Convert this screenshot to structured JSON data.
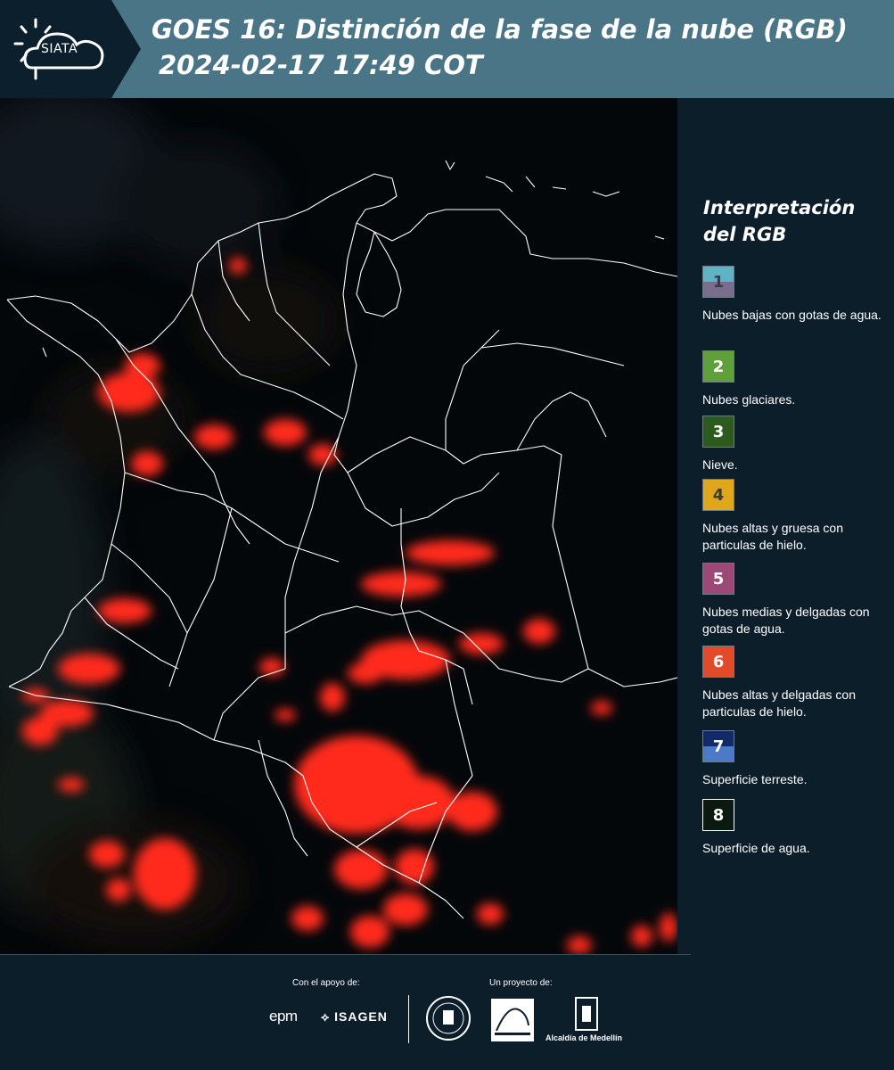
{
  "header": {
    "brand": "SIATA",
    "title_line1": "GOES 16: Distinción de la fase de la nube (RGB)",
    "title_line2": "2024-02-17 17:49 COT"
  },
  "colors": {
    "header_bg": "#4a7586",
    "page_bg": "#0d1e2b",
    "cloud_red": "#ff2a1a"
  },
  "legend": {
    "title": "Interpretación del RGB",
    "items": [
      {
        "number": "1",
        "label": "Nubes bajas con gotas de agua.",
        "color_top": "#5fb3c4",
        "color_bottom": "#7a6e8e"
      },
      {
        "number": "2",
        "label": "Nubes glaciares.",
        "color_top": "#5fa03a",
        "color_bottom": "#5fa03a"
      },
      {
        "number": "3",
        "label": "Nieve.",
        "color_top": "#2d5a1e",
        "color_bottom": "#2d5a1e"
      },
      {
        "number": "4",
        "label": "Nubes altas y gruesa con particulas de hielo.",
        "color_top": "#e0a71c",
        "color_bottom": "#e0a71c"
      },
      {
        "number": "5",
        "label": "Nubes medias y delgadas con gotas de agua.",
        "color_top": "#9e4878",
        "color_bottom": "#9e4878"
      },
      {
        "number": "6",
        "label": "Nubes altas y delgadas con particulas de hielo.",
        "color_top": "#e34a2a",
        "color_bottom": "#e34a2a"
      },
      {
        "number": "7",
        "label": "Superficie terreste.",
        "color_top": "#102a6a",
        "color_bottom": "#4d7ac8"
      },
      {
        "number": "8",
        "label": "Superficie de agua.",
        "color_top": "#0a1a10",
        "color_bottom": "#0a1a10"
      }
    ]
  },
  "footer": {
    "support_label": "Con el apoyo de:",
    "project_label": "Un proyecto de:",
    "sponsor1": "epm",
    "sponsor2": "ISAGEN",
    "org3": "Alcaldía de Medellín"
  }
}
